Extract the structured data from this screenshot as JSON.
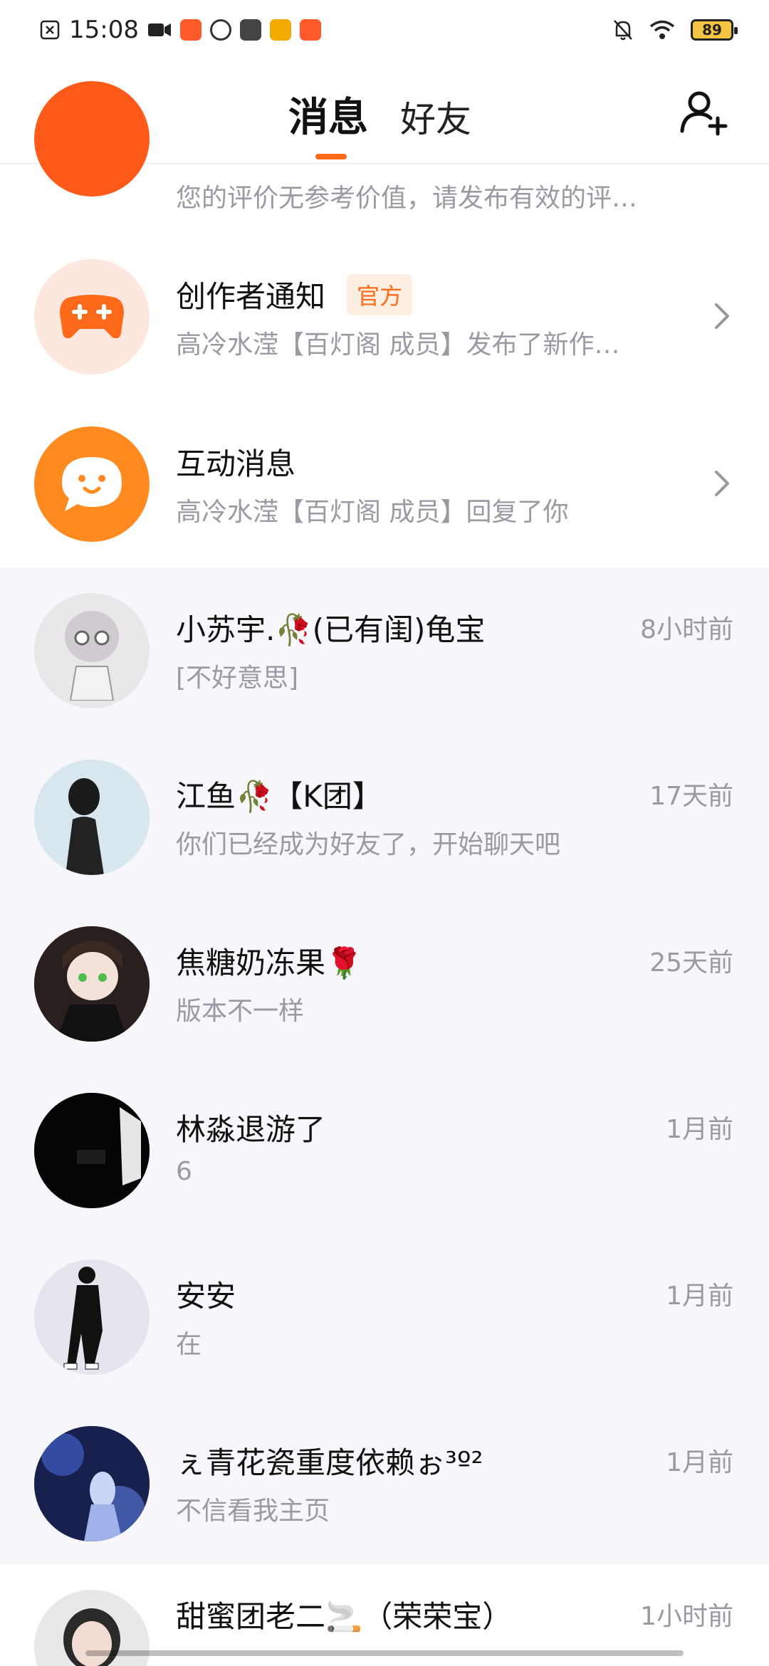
{
  "status_bar": {
    "time": "15:08",
    "battery": "89"
  },
  "header": {
    "tab_messages": "消息",
    "tab_friends": "好友"
  },
  "official": [
    {
      "name": "",
      "preview": "您的评价无参考价值，请发布有效的评…"
    },
    {
      "name": "创作者通知",
      "badge": "官方",
      "preview": "高冷水滢【百灯阁 成员】发布了新作…"
    },
    {
      "name": "互动消息",
      "preview": "高冷水滢【百灯阁 成员】回复了你"
    }
  ],
  "chats": [
    {
      "name": "小苏宇.🥀(已有闺)龟宝",
      "preview": "[不好意思]",
      "time": "8小时前"
    },
    {
      "name": "江鱼🥀【K团】",
      "preview": "你们已经成为好友了，开始聊天吧",
      "time": "17天前"
    },
    {
      "name": "焦糖奶冻果🌹",
      "preview": "版本不一样",
      "time": "25天前"
    },
    {
      "name": "林淼退游了",
      "preview": "6",
      "time": "1月前"
    },
    {
      "name": "安安",
      "preview": "在",
      "time": "1月前"
    },
    {
      "name": "ぇ青花瓷重度依赖ぉ³º²",
      "preview": "不信看我主页",
      "time": "1月前"
    },
    {
      "name": "甜蜜团老二🚬（荣荣宝）",
      "preview": "",
      "time": "1小时前"
    }
  ],
  "colors": {
    "accent": "#ff6a1a",
    "orange_avatar": "#ff8a1f",
    "light_avatar_bg": "#fde7de"
  }
}
